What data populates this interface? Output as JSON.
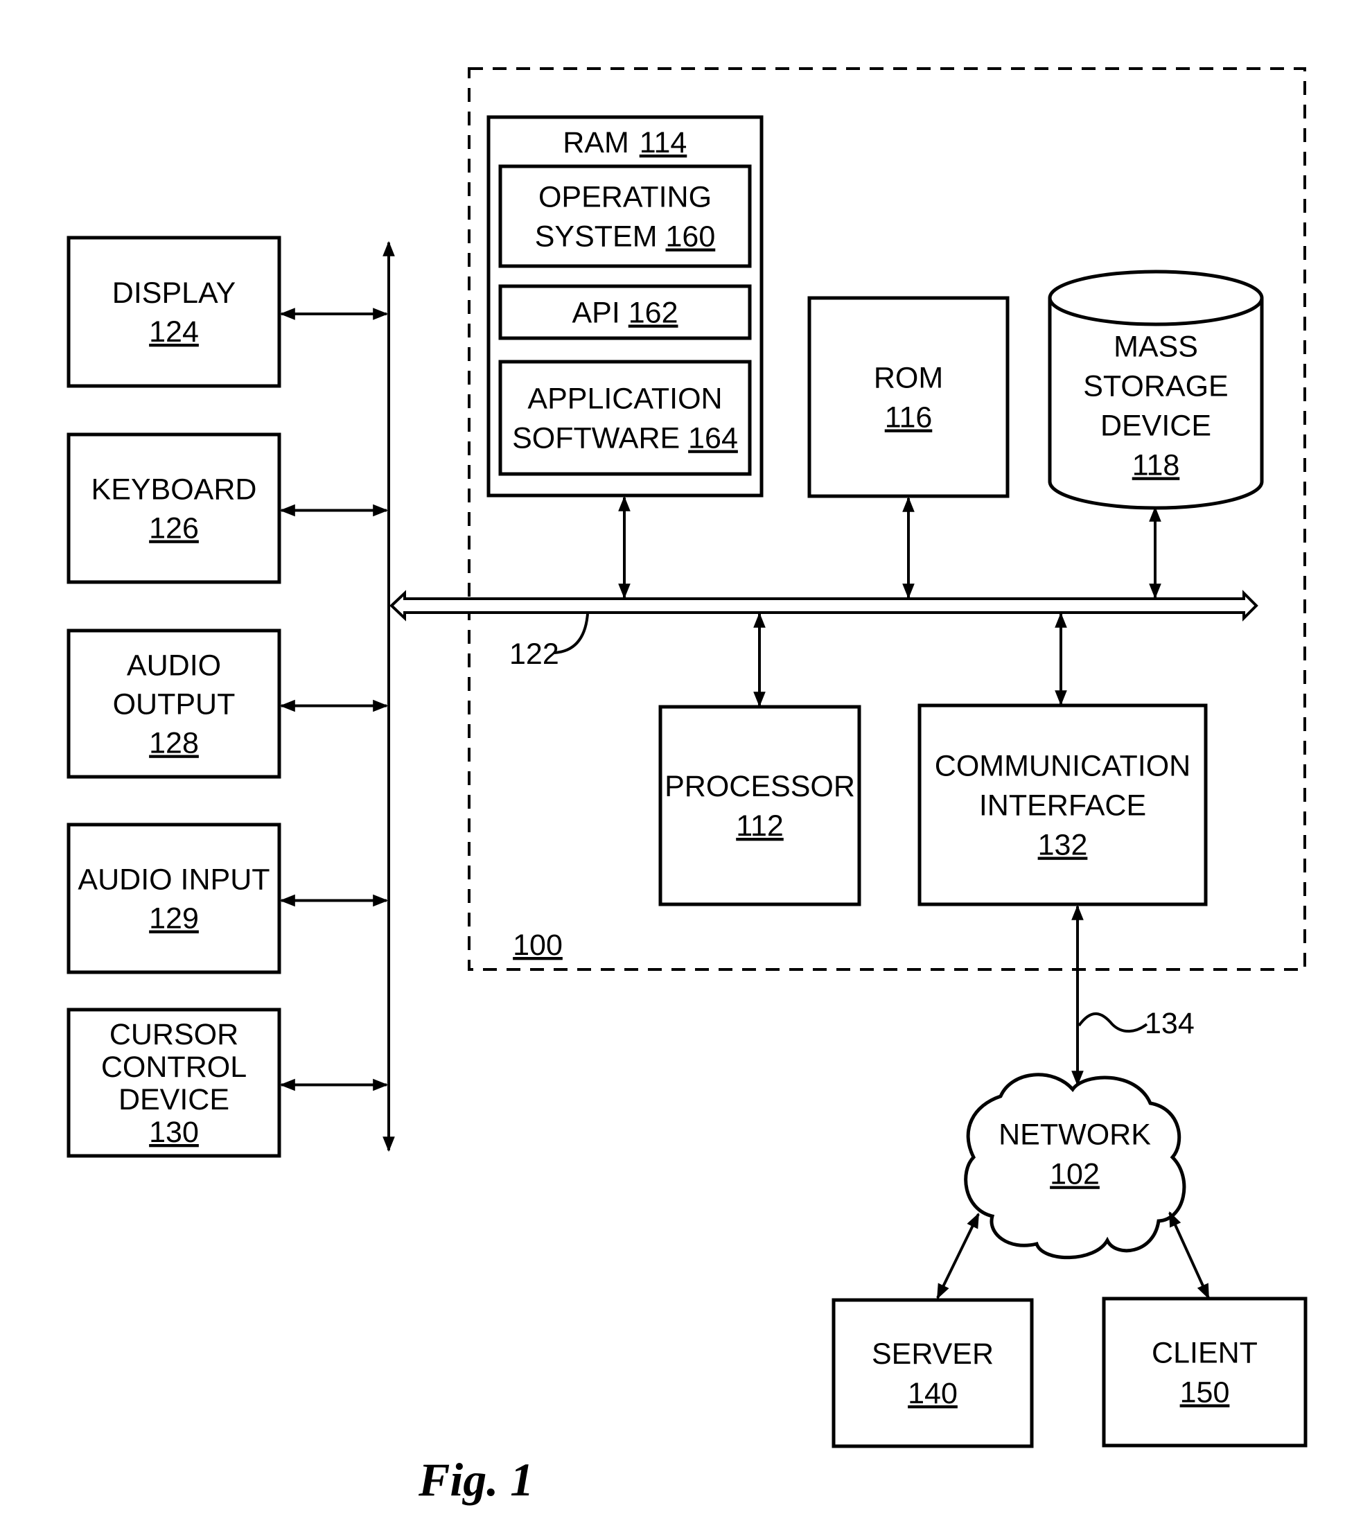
{
  "figure": {
    "caption": "Fig. 1",
    "system": {
      "ref": "100"
    },
    "bus": {
      "ref": "122"
    },
    "link": {
      "ref": "134"
    }
  },
  "peripherals": [
    {
      "id": "display",
      "lines": [
        "DISPLAY"
      ],
      "ref": "124"
    },
    {
      "id": "keyboard",
      "lines": [
        "KEYBOARD"
      ],
      "ref": "126"
    },
    {
      "id": "audio-output",
      "lines": [
        "AUDIO",
        "OUTPUT"
      ],
      "ref": "128"
    },
    {
      "id": "audio-input",
      "lines": [
        "AUDIO INPUT"
      ],
      "ref": "129"
    },
    {
      "id": "cursor-control-device",
      "lines": [
        "CURSOR",
        "CONTROL",
        "DEVICE"
      ],
      "ref": "130"
    }
  ],
  "ram": {
    "label": "RAM",
    "ref": "114",
    "children": [
      {
        "id": "operating-system",
        "lines": [
          "OPERATING",
          "SYSTEM"
        ],
        "ref": "160"
      },
      {
        "id": "api",
        "lines": [
          "API"
        ],
        "ref": "162"
      },
      {
        "id": "application-software",
        "lines": [
          "APPLICATION",
          "SOFTWARE"
        ],
        "ref": "164"
      }
    ]
  },
  "rom": {
    "lines": [
      "ROM"
    ],
    "ref": "116"
  },
  "mass_storage": {
    "lines": [
      "MASS",
      "STORAGE",
      "DEVICE"
    ],
    "ref": "118"
  },
  "processor": {
    "lines": [
      "PROCESSOR"
    ],
    "ref": "112"
  },
  "communication_interface": {
    "lines": [
      "COMMUNICATION",
      "INTERFACE"
    ],
    "ref": "132"
  },
  "network": {
    "lines": [
      "NETWORK"
    ],
    "ref": "102"
  },
  "server": {
    "lines": [
      "SERVER"
    ],
    "ref": "140"
  },
  "client": {
    "lines": [
      "CLIENT"
    ],
    "ref": "150"
  }
}
